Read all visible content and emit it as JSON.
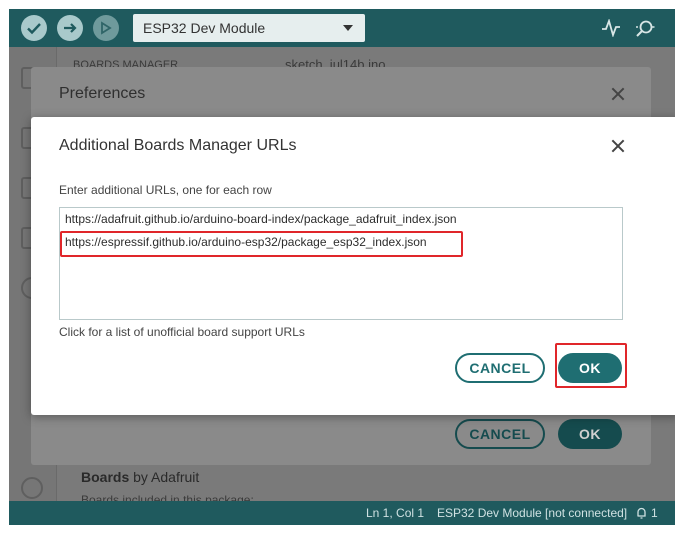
{
  "toolbar": {
    "verify_icon": "check-icon",
    "upload_icon": "arrow-right-icon",
    "debug_icon": "debug-icon",
    "board_select": "ESP32 Dev Module",
    "serial_plotter_icon": "pulse-icon",
    "serial_monitor_icon": "magnifier-icon",
    "color": "#1f5a5e"
  },
  "behind": {
    "panel_title": "BOARDS MANAGER",
    "sketch_tab": "sketch_jul14b.ino",
    "board_item_name": "Boards",
    "board_item_by": "by Adafruit",
    "board_item_sub": "Boards included in this package:"
  },
  "preferences": {
    "title": "Preferences",
    "cancel_label": "CANCEL",
    "ok_label": "OK"
  },
  "url_dialog": {
    "title": "Additional Boards Manager URLs",
    "instruction": "Enter additional URLs, one for each row",
    "urls": [
      "https://adafruit.github.io/arduino-board-index/package_adafruit_index.json",
      "https://espressif.github.io/arduino-esp32/package_esp32_index.json"
    ],
    "link_text": "Click for a list of unofficial board support URLs",
    "cancel_label": "CANCEL",
    "ok_label": "OK",
    "highlight_color": "#e0262a",
    "accent_color": "#1f6e72"
  },
  "statusbar": {
    "position": "Ln 1, Col 1",
    "board_status": "ESP32 Dev Module [not connected]",
    "notifications": "1",
    "notification_icon": "bell-icon"
  }
}
